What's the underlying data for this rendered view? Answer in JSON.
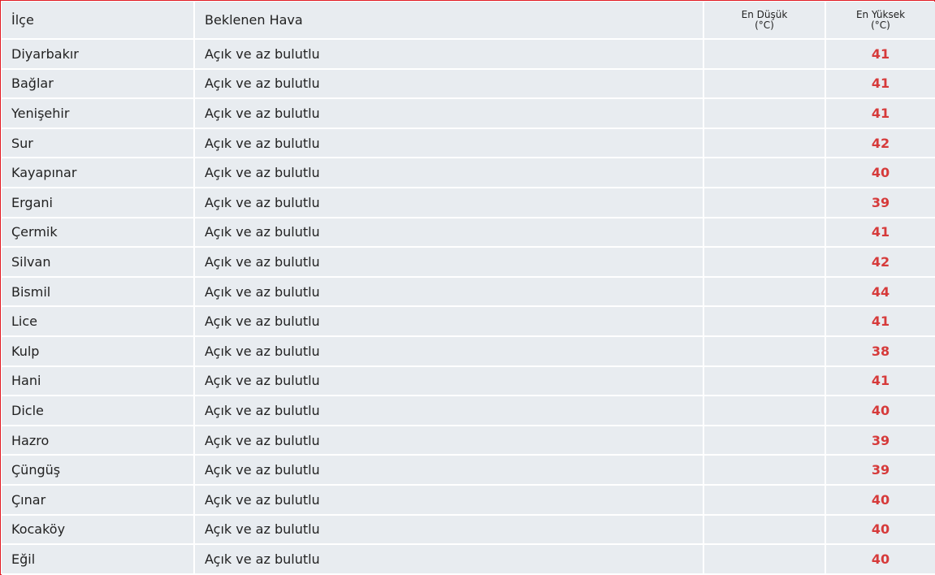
{
  "headers": {
    "district": "İlçe",
    "expected": "Beklenen Hava",
    "min_line1": "En Düşük",
    "min_line2": "(°C)",
    "max_line1": "En Yüksek",
    "max_line2": "(°C)"
  },
  "colors": {
    "frame": "#e01b24",
    "row_bg": "#e8ecf0",
    "max_value": "#d63a3a"
  },
  "rows": [
    {
      "district": "Diyarbakır",
      "weather": "Açık ve az bulutlu",
      "min": "",
      "max": "41"
    },
    {
      "district": "Bağlar",
      "weather": "Açık ve az bulutlu",
      "min": "",
      "max": "41"
    },
    {
      "district": "Yenişehir",
      "weather": "Açık ve az bulutlu",
      "min": "",
      "max": "41"
    },
    {
      "district": "Sur",
      "weather": "Açık ve az bulutlu",
      "min": "",
      "max": "42"
    },
    {
      "district": "Kayapınar",
      "weather": "Açık ve az bulutlu",
      "min": "",
      "max": "40"
    },
    {
      "district": "Ergani",
      "weather": "Açık ve az bulutlu",
      "min": "",
      "max": "39"
    },
    {
      "district": "Çermik",
      "weather": "Açık ve az bulutlu",
      "min": "",
      "max": "41"
    },
    {
      "district": "Silvan",
      "weather": "Açık ve az bulutlu",
      "min": "",
      "max": "42"
    },
    {
      "district": "Bismil",
      "weather": "Açık ve az bulutlu",
      "min": "",
      "max": "44"
    },
    {
      "district": "Lice",
      "weather": "Açık ve az bulutlu",
      "min": "",
      "max": "41"
    },
    {
      "district": "Kulp",
      "weather": "Açık ve az bulutlu",
      "min": "",
      "max": "38"
    },
    {
      "district": "Hani",
      "weather": "Açık ve az bulutlu",
      "min": "",
      "max": "41"
    },
    {
      "district": "Dicle",
      "weather": "Açık ve az bulutlu",
      "min": "",
      "max": "40"
    },
    {
      "district": "Hazro",
      "weather": "Açık ve az bulutlu",
      "min": "",
      "max": "39"
    },
    {
      "district": "Çüngüş",
      "weather": "Açık ve az bulutlu",
      "min": "",
      "max": "39"
    },
    {
      "district": "Çınar",
      "weather": "Açık ve az bulutlu",
      "min": "",
      "max": "40"
    },
    {
      "district": "Kocaköy",
      "weather": "Açık ve az bulutlu",
      "min": "",
      "max": "40"
    },
    {
      "district": "Eğil",
      "weather": "Açık ve az bulutlu",
      "min": "",
      "max": "40"
    }
  ]
}
